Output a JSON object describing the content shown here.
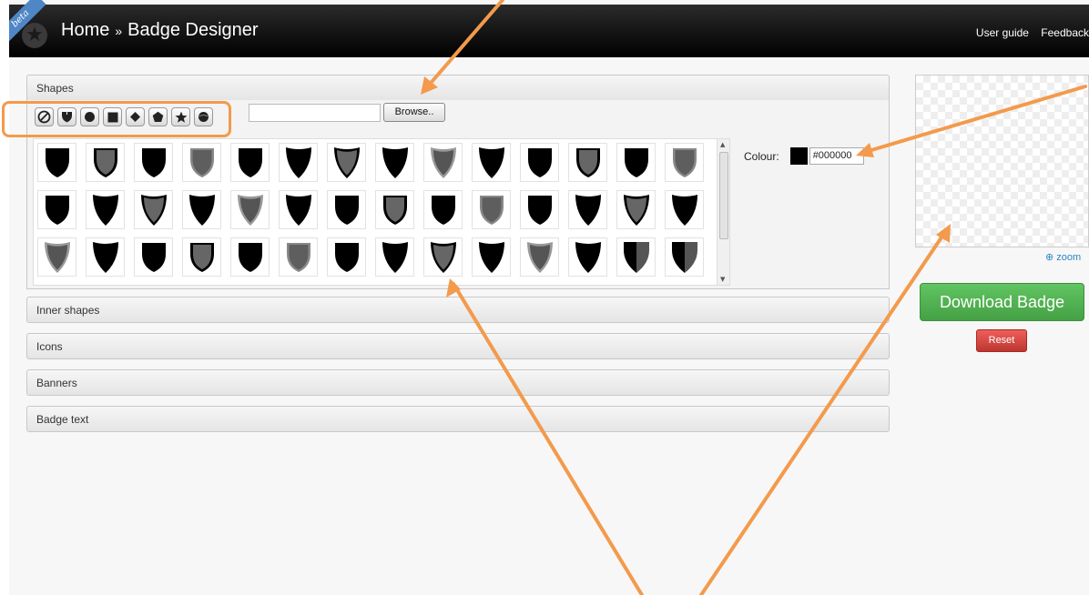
{
  "topbar": {
    "beta": "beta",
    "home": "Home",
    "separator": "»",
    "current": "Badge Designer",
    "links": [
      "User guide",
      "Feedback"
    ]
  },
  "sections": {
    "shapes": "Shapes",
    "inner_shapes": "Inner shapes",
    "icons": "Icons",
    "banners": "Banners",
    "badge_text": "Badge text"
  },
  "filter_icons": [
    "none-icon",
    "shield-icon",
    "circle-icon",
    "square-icon",
    "diamond-icon",
    "pentagon-icon",
    "star-icon",
    "sphere-icon"
  ],
  "upload": {
    "browse_label": "Browse..",
    "value": ""
  },
  "colour": {
    "label": "Colour:",
    "value": "#000000"
  },
  "preview": {
    "zoom_label": "zoom"
  },
  "actions": {
    "download": "Download Badge",
    "reset": "Reset"
  },
  "colors": {
    "annotation": "#f39a4c",
    "download": "#5bb75b",
    "reset": "#da4f49"
  },
  "shapes_grid": [
    [
      "A",
      "B",
      "A",
      "C",
      "A",
      "D",
      "E",
      "D",
      "F",
      "D",
      "A",
      "B",
      "A",
      "C"
    ],
    [
      "A",
      "D",
      "E",
      "D",
      "F",
      "D",
      "A",
      "B",
      "A",
      "C",
      "A",
      "D",
      "E",
      "D"
    ],
    [
      "F",
      "D",
      "A",
      "B",
      "A",
      "C",
      "A",
      "D",
      "E",
      "D",
      "F",
      "D",
      "G",
      "G"
    ]
  ]
}
